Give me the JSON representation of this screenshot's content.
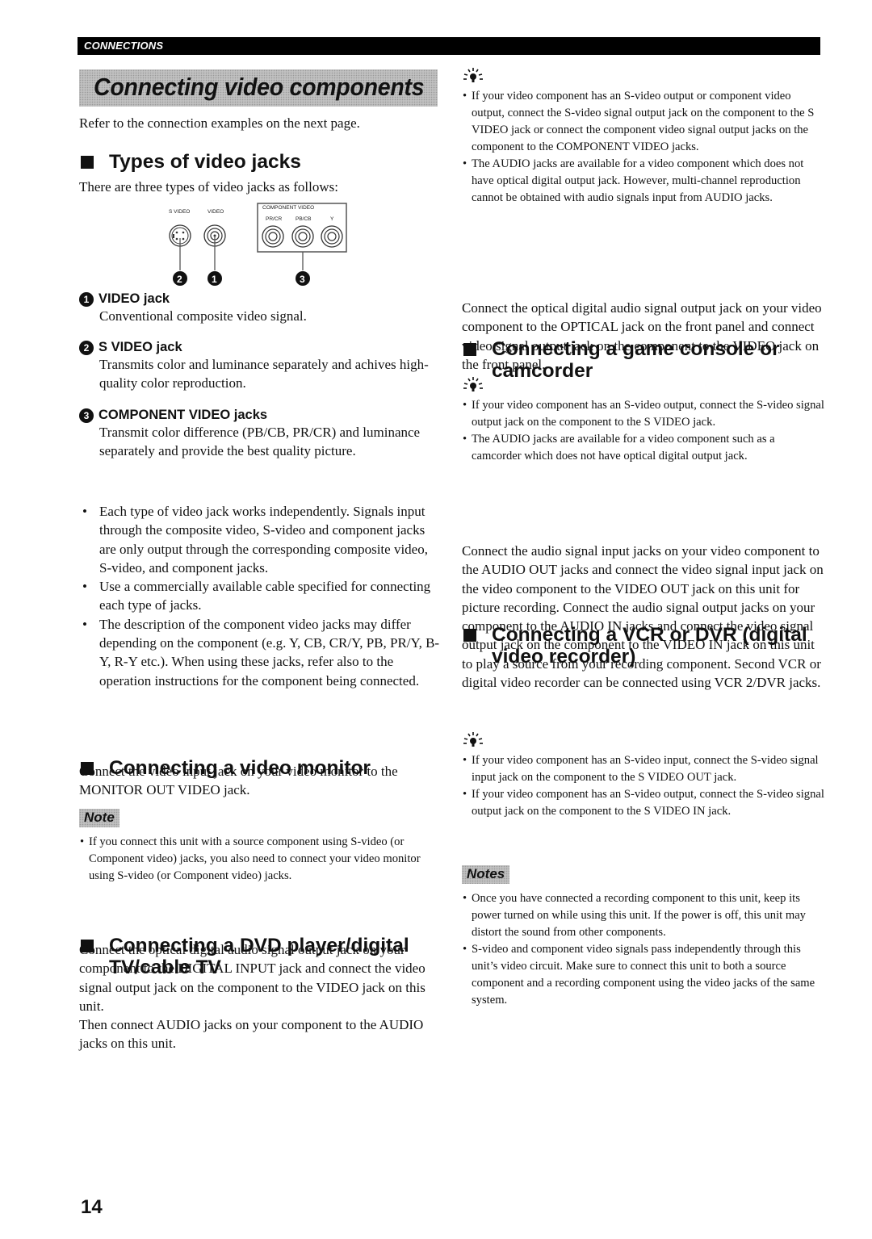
{
  "header": {
    "section": "CONNECTIONS"
  },
  "title": "Connecting video components",
  "intro": "Refer to the connection examples on the next page.",
  "types_section": {
    "heading": "Types of video jacks",
    "intro": "There are three types of video jacks as follows:",
    "diagram": {
      "svideo_label": "S VIDEO",
      "video_label": "VIDEO",
      "component_label": "COMPONENT VIDEO",
      "pr_label": "PR/CR",
      "pb_label": "PB/CB",
      "y_label": "Y",
      "callouts": [
        "2",
        "1",
        "3"
      ]
    },
    "jacks": [
      {
        "num": "1",
        "title": "VIDEO jack",
        "desc": "Conventional composite video signal."
      },
      {
        "num": "2",
        "title": "S VIDEO jack",
        "desc": "Transmits color and luminance separately and achives high-quality color reproduction."
      },
      {
        "num": "3",
        "title": "COMPONENT VIDEO jacks",
        "desc": "Transmit color difference (PB/CB, PR/CR) and luminance separately and provide the best quality picture."
      }
    ],
    "bullets": [
      "Each type of video jack works independently. Signals input through the composite video, S-video and component jacks are only output through the corresponding composite video, S-video, and component jacks.",
      "Use a commercially available cable specified for connecting each type of jacks.",
      "The description of the component video jacks may differ depending on the component (e.g. Y, CB, CR/Y, PB, PR/Y, B-Y, R-Y etc.). When using these jacks, refer also to the operation instructions for the component being connected."
    ]
  },
  "monitor_section": {
    "heading": "Connecting a video monitor",
    "body": "Connect the video input jack on your video monitor to the MONITOR OUT VIDEO jack.",
    "note_label": "Note",
    "notes": [
      "If you connect this unit with a source component using S-video (or Component video) jacks, you also need to connect your video monitor using S-video (or Component video) jacks."
    ]
  },
  "dvd_section": {
    "heading": "Connecting a DVD player/digital TV/cable TV",
    "body1": "Connect the optical digital audio signal output jack on your component to the DIGITAL INPUT jack and connect the video signal output jack on the component to the VIDEO jack on this unit.",
    "body2": "Then connect AUDIO jacks on your component to the AUDIO jacks on this unit."
  },
  "dvd_tips": {
    "icon": "tip-lightbulb-icon",
    "items": [
      "If your video component has an S-video output or component video output, connect the S-video signal output jack on the component to the S VIDEO jack or connect the component video signal output jacks on the component to the COMPONENT VIDEO jacks.",
      "The AUDIO jacks are available for a video component which does not have optical digital output jack. However, multi-channel reproduction cannot be obtained with audio signals input from AUDIO jacks."
    ]
  },
  "game_section": {
    "heading": "Connecting a game console or camcorder",
    "body": "Connect the optical digital audio signal output jack on your video component to the OPTICAL jack on the front panel and connect video signal output jack on the component to the VIDEO jack on the front panel.",
    "tips": [
      "If your video component has an S-video output, connect the S-video signal output jack on the component to the S VIDEO jack.",
      "The AUDIO jacks are available for a video component such as a camcorder which does not have optical digital output jack."
    ]
  },
  "vcr_section": {
    "heading": "Connecting a VCR or DVR (digital video recorder)",
    "body": "Connect the audio signal input jacks on your video component to the AUDIO OUT jacks and connect the video signal input jack on the video component to the VIDEO OUT jack on this unit for picture recording. Connect the audio signal output jacks on your component to the AUDIO IN jacks and connect the video signal output jack on the component to the VIDEO IN jack on this unit to play a source from your recording component. Second VCR or digital video recorder can be connected using VCR 2/DVR jacks.",
    "tips": [
      "If your video component has an S-video input, connect the S-video signal input jack on the component to the S VIDEO OUT jack.",
      "If your video component has an S-video output, connect the S-video signal output jack on the component to the S VIDEO IN jack."
    ],
    "notes_label": "Notes",
    "notes": [
      "Once you have connected a recording component to this unit, keep its power turned on while using this unit. If the power is off, this unit may distort the sound from other components.",
      "S-video and component video signals pass independently through this unit’s video circuit. Make sure to connect this unit to both a source component and a recording component using the video jacks of the same system."
    ]
  },
  "page_number": "14"
}
